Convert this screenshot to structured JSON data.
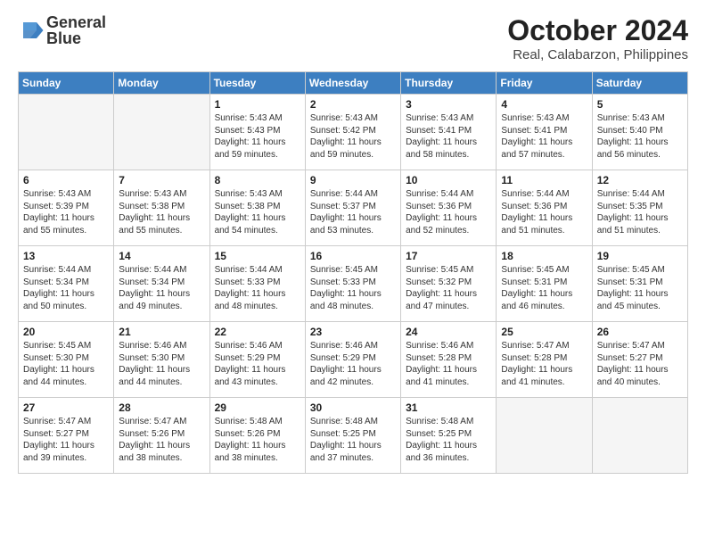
{
  "header": {
    "title": "October 2024",
    "subtitle": "Real, Calabarzon, Philippines",
    "logo_line1": "General",
    "logo_line2": "Blue"
  },
  "days_of_week": [
    "Sunday",
    "Monday",
    "Tuesday",
    "Wednesday",
    "Thursday",
    "Friday",
    "Saturday"
  ],
  "weeks": [
    [
      {
        "day": "",
        "empty": true
      },
      {
        "day": "",
        "empty": true
      },
      {
        "day": "1",
        "sunrise": "Sunrise: 5:43 AM",
        "sunset": "Sunset: 5:43 PM",
        "daylight": "Daylight: 11 hours and 59 minutes."
      },
      {
        "day": "2",
        "sunrise": "Sunrise: 5:43 AM",
        "sunset": "Sunset: 5:42 PM",
        "daylight": "Daylight: 11 hours and 59 minutes."
      },
      {
        "day": "3",
        "sunrise": "Sunrise: 5:43 AM",
        "sunset": "Sunset: 5:41 PM",
        "daylight": "Daylight: 11 hours and 58 minutes."
      },
      {
        "day": "4",
        "sunrise": "Sunrise: 5:43 AM",
        "sunset": "Sunset: 5:41 PM",
        "daylight": "Daylight: 11 hours and 57 minutes."
      },
      {
        "day": "5",
        "sunrise": "Sunrise: 5:43 AM",
        "sunset": "Sunset: 5:40 PM",
        "daylight": "Daylight: 11 hours and 56 minutes."
      }
    ],
    [
      {
        "day": "6",
        "sunrise": "Sunrise: 5:43 AM",
        "sunset": "Sunset: 5:39 PM",
        "daylight": "Daylight: 11 hours and 55 minutes."
      },
      {
        "day": "7",
        "sunrise": "Sunrise: 5:43 AM",
        "sunset": "Sunset: 5:38 PM",
        "daylight": "Daylight: 11 hours and 55 minutes."
      },
      {
        "day": "8",
        "sunrise": "Sunrise: 5:43 AM",
        "sunset": "Sunset: 5:38 PM",
        "daylight": "Daylight: 11 hours and 54 minutes."
      },
      {
        "day": "9",
        "sunrise": "Sunrise: 5:44 AM",
        "sunset": "Sunset: 5:37 PM",
        "daylight": "Daylight: 11 hours and 53 minutes."
      },
      {
        "day": "10",
        "sunrise": "Sunrise: 5:44 AM",
        "sunset": "Sunset: 5:36 PM",
        "daylight": "Daylight: 11 hours and 52 minutes."
      },
      {
        "day": "11",
        "sunrise": "Sunrise: 5:44 AM",
        "sunset": "Sunset: 5:36 PM",
        "daylight": "Daylight: 11 hours and 51 minutes."
      },
      {
        "day": "12",
        "sunrise": "Sunrise: 5:44 AM",
        "sunset": "Sunset: 5:35 PM",
        "daylight": "Daylight: 11 hours and 51 minutes."
      }
    ],
    [
      {
        "day": "13",
        "sunrise": "Sunrise: 5:44 AM",
        "sunset": "Sunset: 5:34 PM",
        "daylight": "Daylight: 11 hours and 50 minutes."
      },
      {
        "day": "14",
        "sunrise": "Sunrise: 5:44 AM",
        "sunset": "Sunset: 5:34 PM",
        "daylight": "Daylight: 11 hours and 49 minutes."
      },
      {
        "day": "15",
        "sunrise": "Sunrise: 5:44 AM",
        "sunset": "Sunset: 5:33 PM",
        "daylight": "Daylight: 11 hours and 48 minutes."
      },
      {
        "day": "16",
        "sunrise": "Sunrise: 5:45 AM",
        "sunset": "Sunset: 5:33 PM",
        "daylight": "Daylight: 11 hours and 48 minutes."
      },
      {
        "day": "17",
        "sunrise": "Sunrise: 5:45 AM",
        "sunset": "Sunset: 5:32 PM",
        "daylight": "Daylight: 11 hours and 47 minutes."
      },
      {
        "day": "18",
        "sunrise": "Sunrise: 5:45 AM",
        "sunset": "Sunset: 5:31 PM",
        "daylight": "Daylight: 11 hours and 46 minutes."
      },
      {
        "day": "19",
        "sunrise": "Sunrise: 5:45 AM",
        "sunset": "Sunset: 5:31 PM",
        "daylight": "Daylight: 11 hours and 45 minutes."
      }
    ],
    [
      {
        "day": "20",
        "sunrise": "Sunrise: 5:45 AM",
        "sunset": "Sunset: 5:30 PM",
        "daylight": "Daylight: 11 hours and 44 minutes."
      },
      {
        "day": "21",
        "sunrise": "Sunrise: 5:46 AM",
        "sunset": "Sunset: 5:30 PM",
        "daylight": "Daylight: 11 hours and 44 minutes."
      },
      {
        "day": "22",
        "sunrise": "Sunrise: 5:46 AM",
        "sunset": "Sunset: 5:29 PM",
        "daylight": "Daylight: 11 hours and 43 minutes."
      },
      {
        "day": "23",
        "sunrise": "Sunrise: 5:46 AM",
        "sunset": "Sunset: 5:29 PM",
        "daylight": "Daylight: 11 hours and 42 minutes."
      },
      {
        "day": "24",
        "sunrise": "Sunrise: 5:46 AM",
        "sunset": "Sunset: 5:28 PM",
        "daylight": "Daylight: 11 hours and 41 minutes."
      },
      {
        "day": "25",
        "sunrise": "Sunrise: 5:47 AM",
        "sunset": "Sunset: 5:28 PM",
        "daylight": "Daylight: 11 hours and 41 minutes."
      },
      {
        "day": "26",
        "sunrise": "Sunrise: 5:47 AM",
        "sunset": "Sunset: 5:27 PM",
        "daylight": "Daylight: 11 hours and 40 minutes."
      }
    ],
    [
      {
        "day": "27",
        "sunrise": "Sunrise: 5:47 AM",
        "sunset": "Sunset: 5:27 PM",
        "daylight": "Daylight: 11 hours and 39 minutes."
      },
      {
        "day": "28",
        "sunrise": "Sunrise: 5:47 AM",
        "sunset": "Sunset: 5:26 PM",
        "daylight": "Daylight: 11 hours and 38 minutes."
      },
      {
        "day": "29",
        "sunrise": "Sunrise: 5:48 AM",
        "sunset": "Sunset: 5:26 PM",
        "daylight": "Daylight: 11 hours and 38 minutes."
      },
      {
        "day": "30",
        "sunrise": "Sunrise: 5:48 AM",
        "sunset": "Sunset: 5:25 PM",
        "daylight": "Daylight: 11 hours and 37 minutes."
      },
      {
        "day": "31",
        "sunrise": "Sunrise: 5:48 AM",
        "sunset": "Sunset: 5:25 PM",
        "daylight": "Daylight: 11 hours and 36 minutes."
      },
      {
        "day": "",
        "empty": true
      },
      {
        "day": "",
        "empty": true
      }
    ]
  ]
}
